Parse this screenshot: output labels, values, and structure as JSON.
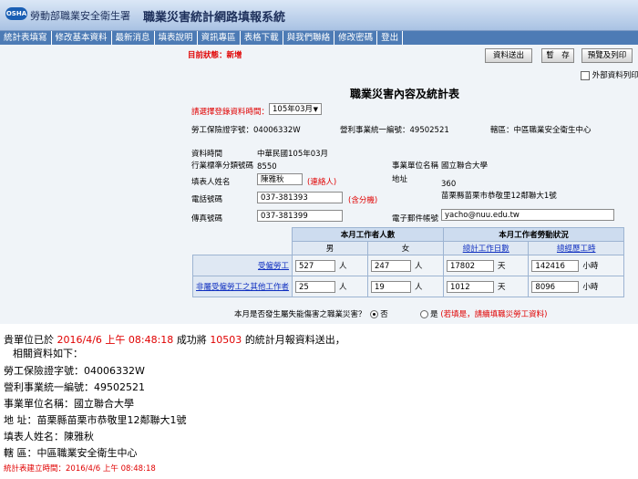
{
  "header": {
    "logo_text": "OSHA",
    "agency": "勞動部職業安全衛生署",
    "system_title": "職業災害統計網路填報系統"
  },
  "nav": [
    "統計表填寫",
    "修改基本資料",
    "最新消息",
    "填表說明",
    "資訊專區",
    "表格下載",
    "與我們聯絡",
    "修改密碼",
    "登出"
  ],
  "form": {
    "status": "目前狀態：新增",
    "buttons": {
      "send": "資料送出",
      "pause": "暫　存",
      "preview": "預覽及列印"
    },
    "external_print": "外部資料列印",
    "title": "職業災害內容及統計表",
    "select_label": "請選擇登錄資料時間：",
    "select_value": "105年03月",
    "insurance_label": "勞工保險證字號：04006332W",
    "business_id_label": "營利事業統一編號：49502521",
    "district_label": "轄區：中區職業安全衛生中心",
    "data_time_label": "資料時間",
    "data_time_value": "中華民國105年03月",
    "industry_label": "行業標準分類號碼",
    "industry_value": "8550",
    "company_label": "事業單位名稱",
    "company_value": "國立聯合大學",
    "filler_label": "填表人姓名",
    "filler_value": "陳雅秋",
    "filler_note": "(連絡人)",
    "address_label": "地址",
    "address_zip": "360",
    "address_value": "苗栗縣苗栗市恭敬里12鄰聯大1號",
    "phone_label": "電話號碼",
    "phone_value": "037-381393",
    "phone_note": "(含分機)",
    "fax_label": "傳真號碼",
    "fax_value": "037-381399",
    "email_label": "電子郵件帳號",
    "email_value": "yacho@nuu.edu.tw",
    "table": {
      "h_workers": "本月工作者人數",
      "h_labor": "本月工作者勞動狀況",
      "male": "男",
      "female": "女",
      "workdays": "總計工作日數",
      "workhours": "總經歷工時",
      "row1_label": "受僱勞工",
      "row1": {
        "male": "527",
        "female": "247",
        "days": "17802",
        "hours": "142416"
      },
      "row2_label": "非屬受僱勞工之其他工作者",
      "row2": {
        "male": "25",
        "female": "19",
        "days": "1012",
        "hours": "8096"
      },
      "unit_person": "人",
      "unit_day": "天",
      "unit_hour": "小時"
    },
    "accident_q": "本月是否發生屬失能傷害之職業災害？",
    "no": "否",
    "yes": "是",
    "yes_note": "(若填是，請續填職災勞工資料)"
  },
  "message": {
    "line1_prefix": "貴單位已於",
    "line1_time": "2016/4/6 上午 08:48:18",
    "line1_mid": "成功將",
    "line1_period": "10503",
    "line1_suffix": "的統計月報資料送出，",
    "line2": "相關資料如下：",
    "line3": "勞工保險證字號：04006332W",
    "line4": "營利事業統一編號：49502521",
    "line5": "事業單位名稱：國立聯合大學",
    "line6": "地 址：苗栗縣苗栗市恭敬里12鄰聯大1號",
    "line7": "填表人姓名：陳雅秋",
    "line8": "轄 區：中區職業安全衛生中心",
    "created": "統計表建立時間：2016/4/6 上午 08:48:18"
  },
  "colors": {
    "accent_red": "#e00000",
    "nav_bg": "#4d7bb5",
    "link": "#1030c0"
  }
}
